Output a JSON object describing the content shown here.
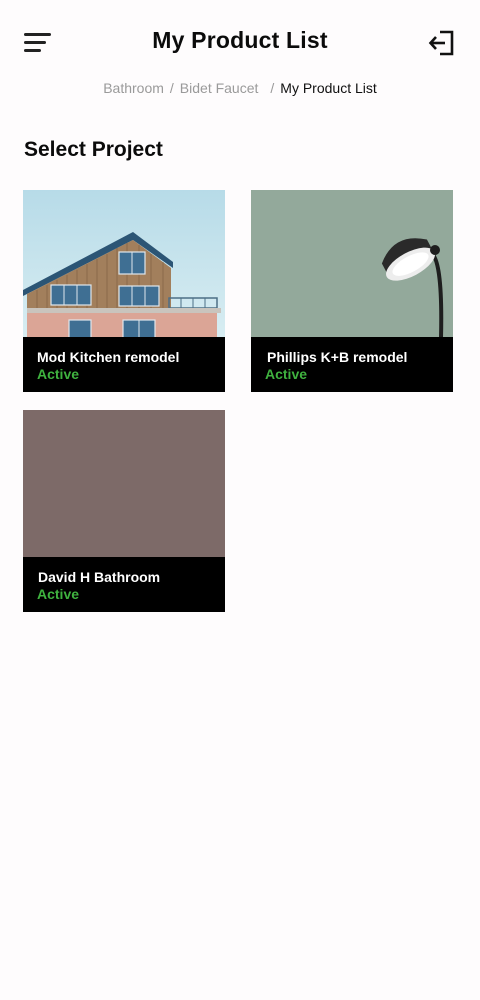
{
  "header": {
    "title": "My Product List",
    "menu_icon": "hamburger-menu-icon",
    "logout_icon": "logout-icon"
  },
  "breadcrumb": {
    "items": [
      "Bathroom",
      "Bidet Faucet"
    ],
    "separator": "/",
    "current": "My Product List"
  },
  "section": {
    "title": "Select Project"
  },
  "projects": [
    {
      "name": "Mod Kitchen remodel",
      "status": "Active",
      "image": "house-photo"
    },
    {
      "name": "Phillips K+B remodel",
      "status": "Active",
      "image": "lamp-photo"
    },
    {
      "name": "David H Bathroom",
      "status": "Active",
      "image": "placeholder",
      "image_color": "#7d6a68"
    }
  ],
  "colors": {
    "status_active": "#3fb23f",
    "caption_bg": "#000000",
    "breadcrumb_link": "#9a9a9a"
  }
}
